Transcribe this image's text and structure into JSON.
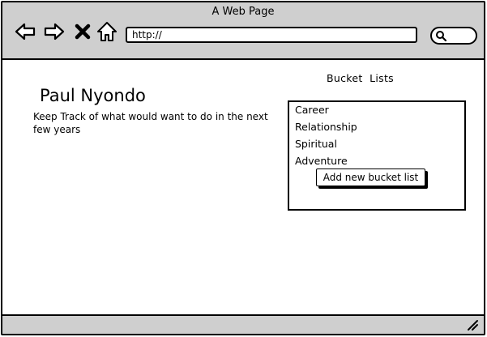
{
  "window": {
    "title": "A Web Page"
  },
  "toolbar": {
    "back_icon": "back-arrow-icon",
    "forward_icon": "forward-arrow-icon",
    "stop_icon": "close-icon",
    "home_icon": "home-icon",
    "url_value": "http://",
    "search_icon": "search-icon"
  },
  "profile": {
    "name": "Paul Nyondo",
    "tagline": "Keep Track of what would want to do in the next few years"
  },
  "bucket": {
    "heading": "Bucket  Lists",
    "items": [
      {
        "label": "Career"
      },
      {
        "label": "Relationship"
      },
      {
        "label": "Spiritual"
      },
      {
        "label": "Adventure"
      }
    ],
    "add_button_label": "Add new bucket list"
  },
  "colors": {
    "chrome": "#cfcfcf",
    "border": "#000000",
    "background": "#ffffff"
  }
}
